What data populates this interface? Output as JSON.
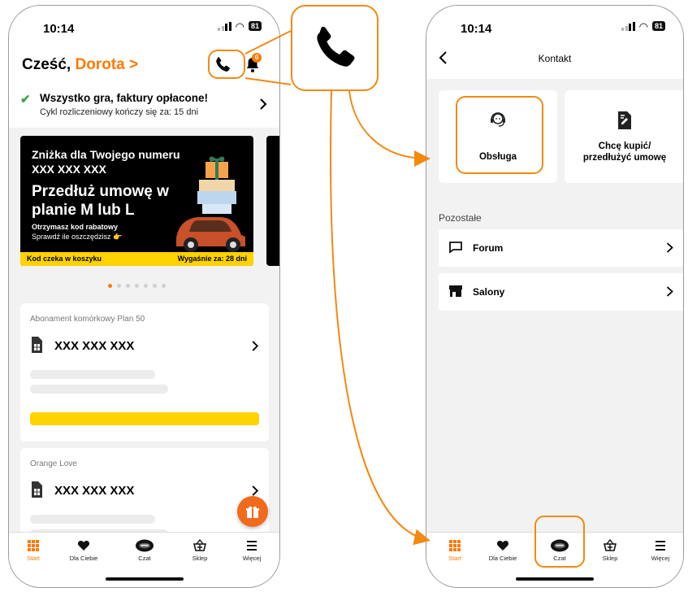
{
  "status": {
    "time": "10:14",
    "battery": "81"
  },
  "left": {
    "greeting_prefix": "Cześć,",
    "user_name": "Dorota >",
    "notif_count": "0",
    "paid_title": "Wszystko gra, faktury opłacone!",
    "paid_sub": "Cykl rozliczeniowy kończy się za: 15 dni",
    "promo": {
      "line1": "Zniżka dla Twojego numeru XXX XXX XXX",
      "big": "Przedłuż umowę w planie M lub L",
      "sub1": "Otrzymasz kod rabatowy",
      "sub2": "Sprawdź ile oszczędzisz 👉",
      "code": "Kod czeka w koszyku",
      "expires": "Wygaśnie za: 28 dni"
    },
    "dots_total": 7,
    "dots_active": 0,
    "cards": [
      {
        "label": "Abonament komórkowy Plan 50",
        "number": "XXX XXX XXX"
      },
      {
        "label": "Orange Love",
        "number": "XXX XXX XXX"
      }
    ]
  },
  "tabs": [
    {
      "label": "Start",
      "icon": "grid-icon",
      "active": true
    },
    {
      "label": "Dla Ciebie",
      "icon": "heart-icon",
      "active": false
    },
    {
      "label": "Czat",
      "icon": "chat-bot-icon",
      "active": false
    },
    {
      "label": "Sklep",
      "icon": "basket-icon",
      "active": false
    },
    {
      "label": "Więcej",
      "icon": "menu-icon",
      "active": false
    }
  ],
  "right": {
    "title": "Kontakt",
    "tile_obsluga": "Obsługa",
    "tile_kup_line1": "Chcę kupić/",
    "tile_kup_line2": "przedłużyć umowę",
    "section": "Pozostałe",
    "rows": [
      {
        "label": "Forum",
        "icon": "chat-bubble-icon"
      },
      {
        "label": "Salony",
        "icon": "store-icon"
      }
    ]
  },
  "colors": {
    "accent": "#ff7900",
    "highlight": "#f28a12",
    "promo_bar": "#ffd200",
    "check": "#3aa644"
  }
}
